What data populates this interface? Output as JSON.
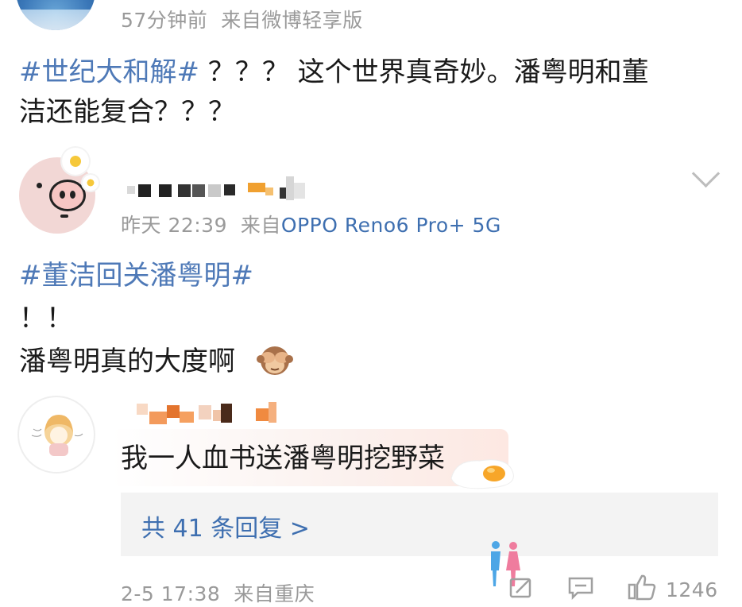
{
  "post": {
    "time": "57分钟前",
    "source": "来自微博轻享版",
    "hashtag": "#世纪大和解#",
    "text_line1": " ？？？ 这个世界真奇妙。潘粤明和董",
    "text_line2": "洁还能复合？？？"
  },
  "comment": {
    "time": "昨天 22:39",
    "source_prefix": "来自",
    "source_device": "OPPO Reno6 Pro+ 5G",
    "hashtag": "#董洁回关潘粤明#",
    "line2": "！！",
    "line3": "潘粤明真的大度啊",
    "emoji": "see-no-evil-monkey-icon"
  },
  "reply": {
    "text": "我一人血书送潘粤明挖野菜",
    "sticker": "fried-egg-icon"
  },
  "replies_link": "共 41 条回复 >",
  "footer": {
    "time": "2-5 17:38",
    "source": "来自重庆",
    "like_count": "1246"
  },
  "colors": {
    "link_blue": "#3e6fb0",
    "gray_text": "#9a9a9a",
    "text": "#1a1a1a",
    "reply_bg": "#f3f3f3"
  }
}
